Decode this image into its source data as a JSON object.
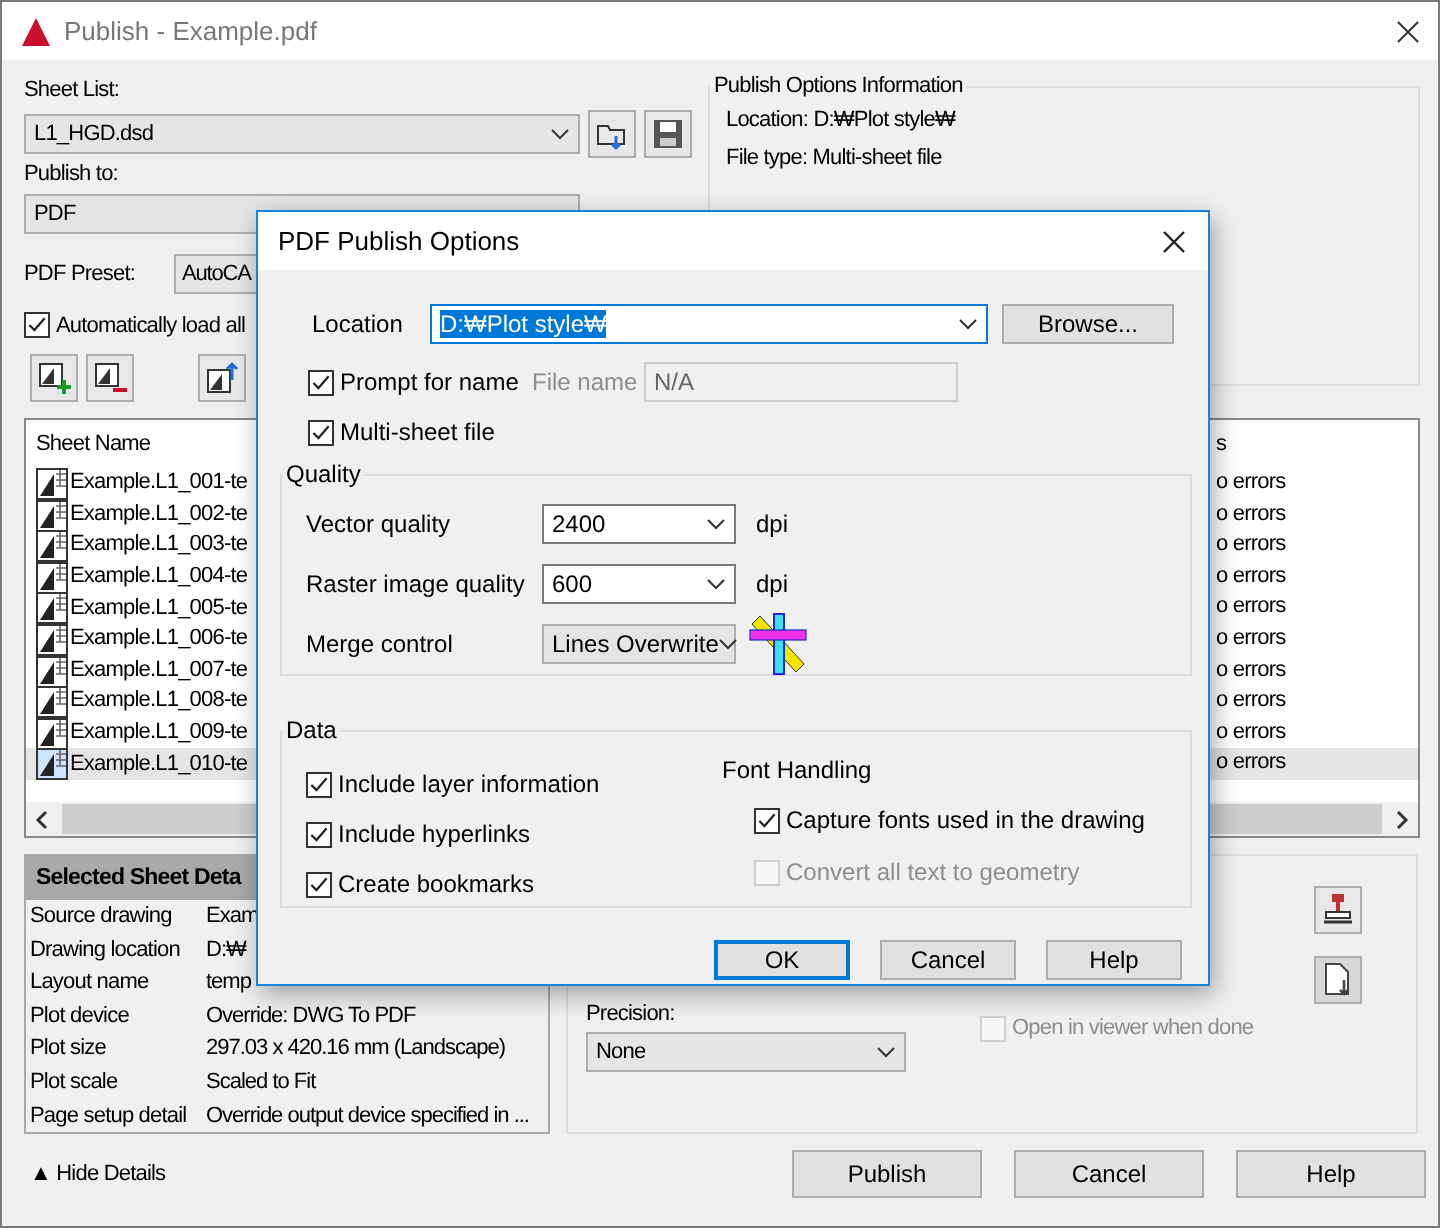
{
  "window": {
    "title": "Publish - Example.pdf"
  },
  "sheet_list": {
    "label": "Sheet List:",
    "value": "L1_HGD.dsd"
  },
  "publish_to": {
    "label": "Publish to:",
    "value": "PDF"
  },
  "pdf_preset": {
    "label": "PDF Preset:",
    "value": "AutoCA"
  },
  "auto_load": {
    "label": "Automatically load all",
    "checked": true
  },
  "publish_options_info": {
    "title": "Publish Options Information",
    "lines": [
      "Location: D:₩Plot style₩",
      "File type: Multi-sheet file"
    ]
  },
  "sheets": {
    "columns": [
      "Sheet Name",
      "s"
    ],
    "rows": [
      {
        "name": "Example.L1_001-te",
        "status": "o errors",
        "selected": false
      },
      {
        "name": "Example.L1_002-te",
        "status": "o errors",
        "selected": false
      },
      {
        "name": "Example.L1_003-te",
        "status": "o errors",
        "selected": false
      },
      {
        "name": "Example.L1_004-te",
        "status": "o errors",
        "selected": false
      },
      {
        "name": "Example.L1_005-te",
        "status": "o errors",
        "selected": false
      },
      {
        "name": "Example.L1_006-te",
        "status": "o errors",
        "selected": false
      },
      {
        "name": "Example.L1_007-te",
        "status": "o errors",
        "selected": false
      },
      {
        "name": "Example.L1_008-te",
        "status": "o errors",
        "selected": false
      },
      {
        "name": "Example.L1_009-te",
        "status": "o errors",
        "selected": false
      },
      {
        "name": "Example.L1_010-te",
        "status": "o errors",
        "selected": true
      }
    ]
  },
  "selected_sheet_details": {
    "title": "Selected Sheet Deta",
    "rows": [
      {
        "label": "Source drawing",
        "value": "Exam"
      },
      {
        "label": "Drawing location",
        "value": "D:₩"
      },
      {
        "label": "Layout name",
        "value": "temp"
      },
      {
        "label": "Plot device",
        "value": "Override: DWG To PDF"
      },
      {
        "label": "Plot size",
        "value": "297.03 x 420.16 mm (Landscape)"
      },
      {
        "label": "Plot scale",
        "value": "Scaled to Fit"
      },
      {
        "label": "Page setup detail",
        "value": "Override output device specified in ..."
      }
    ]
  },
  "precision": {
    "label": "Precision:",
    "value": "None"
  },
  "open_in_viewer": {
    "label": "Open in viewer when done",
    "checked": false,
    "disabled": true
  },
  "hide_details": {
    "toggle": "▲",
    "label": "Hide Details"
  },
  "buttons": [
    "Publish",
    "Cancel",
    "Help"
  ],
  "dialog": {
    "title": "PDF Publish Options",
    "location": {
      "label": "Location",
      "value": "D:₩Plot style₩",
      "highlighted": true
    },
    "browse": "Browse...",
    "prompt_for_name": {
      "label": "Prompt for name",
      "checked": true
    },
    "file_name": {
      "label": "File name",
      "value": "N/A",
      "disabled": true
    },
    "multi_sheet": {
      "label": "Multi-sheet file",
      "checked": true
    },
    "quality": {
      "title": "Quality",
      "fields": [
        {
          "label": "Vector quality",
          "value": "2400",
          "unit": "dpi",
          "kind": "editable"
        },
        {
          "label": "Raster image quality",
          "value": "600",
          "unit": "dpi",
          "kind": "editable"
        },
        {
          "label": "Merge control",
          "value": "Lines Overwrite",
          "kind": "list"
        }
      ]
    },
    "data": {
      "title": "Data",
      "options": [
        {
          "label": "Include layer information",
          "checked": true
        },
        {
          "label": "Include hyperlinks",
          "checked": true
        },
        {
          "label": "Create bookmarks",
          "checked": true
        }
      ],
      "font_handling": {
        "title": "Font Handling",
        "options": [
          {
            "label": "Capture fonts used in the drawing",
            "checked": true,
            "disabled": false
          },
          {
            "label": "Convert all text to geometry",
            "checked": false,
            "disabled": true
          }
        ]
      }
    },
    "buttons": [
      {
        "label": "OK",
        "default": true
      },
      {
        "label": "Cancel",
        "default": false
      },
      {
        "label": "Help",
        "default": false
      }
    ]
  }
}
